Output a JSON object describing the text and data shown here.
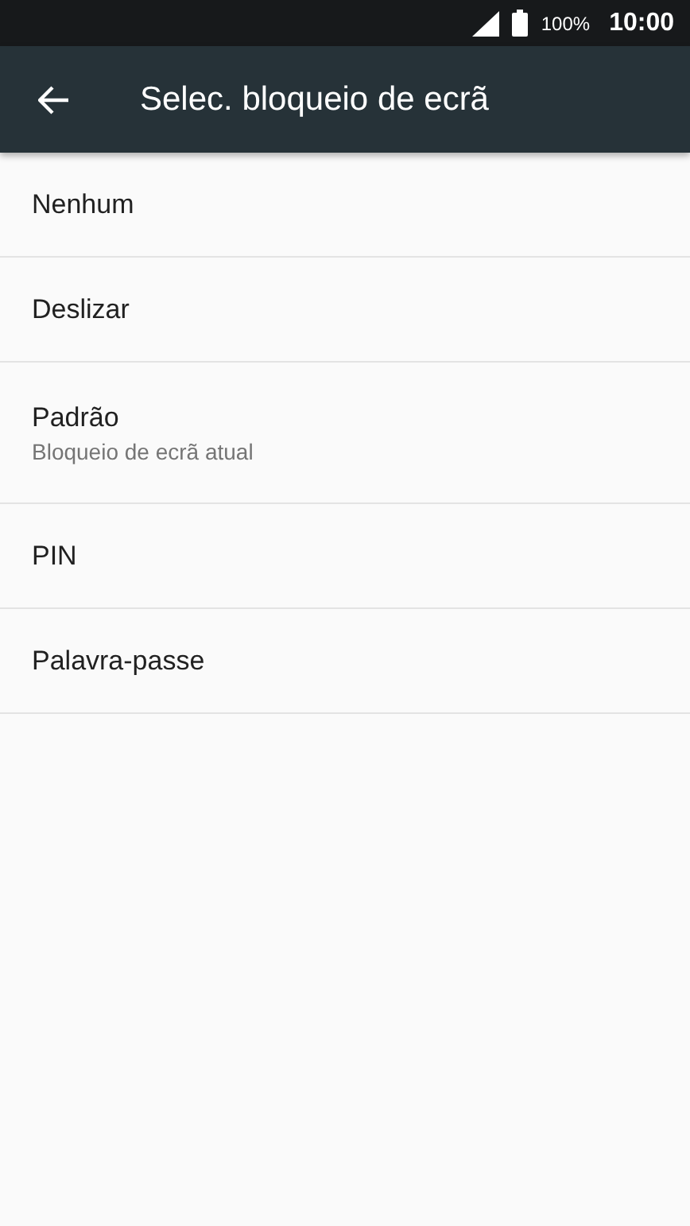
{
  "status_bar": {
    "battery": "100%",
    "time": "10:00"
  },
  "toolbar": {
    "title": "Selec. bloqueio de ecrã"
  },
  "options": [
    {
      "title": "Nenhum"
    },
    {
      "title": "Deslizar"
    },
    {
      "title": "Padrão",
      "subtitle": "Bloqueio de ecrã atual"
    },
    {
      "title": "PIN"
    },
    {
      "title": "Palavra-passe"
    }
  ]
}
